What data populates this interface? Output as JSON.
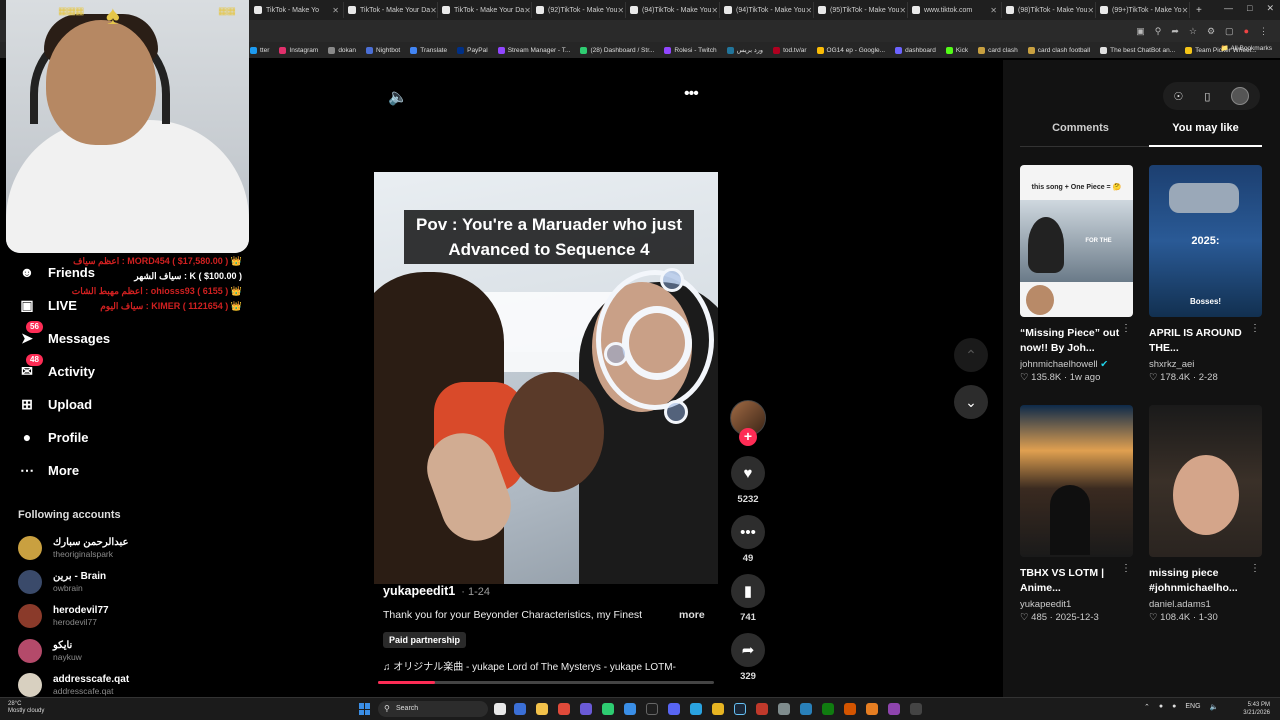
{
  "browser": {
    "tabs": [
      {
        "label": "TikTok - Make Yo"
      },
      {
        "label": "TikTok - Make Your Da"
      },
      {
        "label": "TikTok - Make Your Da"
      },
      {
        "label": "(92)TikTok - Make You"
      },
      {
        "label": "(94)TikTok - Make You"
      },
      {
        "label": "(94)TikTok - Make You"
      },
      {
        "label": "(95)TikTok - Make You"
      },
      {
        "label": "www.tiktok.com"
      },
      {
        "label": "(98)TikTok - Make You"
      },
      {
        "label": "(99+)TikTok - Make Yo"
      }
    ],
    "bookmarks": [
      {
        "label": "tter",
        "color": "#1d9bf0"
      },
      {
        "label": "Instagram",
        "color": "#e1306c"
      },
      {
        "label": "dokan",
        "color": "#8a8a8a"
      },
      {
        "label": "Nightbot",
        "color": "#4b6fd6"
      },
      {
        "label": "Translate",
        "color": "#4285f4"
      },
      {
        "label": "PayPal",
        "color": "#003087"
      },
      {
        "label": "Stream Manager - T...",
        "color": "#9146ff"
      },
      {
        "label": "(28) Dashboard / Str...",
        "color": "#2ecc71"
      },
      {
        "label": "Rolesi - Twitch",
        "color": "#9146ff"
      },
      {
        "label": "ورد بريس",
        "color": "#21759b"
      },
      {
        "label": "tod.tv/ar",
        "color": "#b00020"
      },
      {
        "label": "OG14 ep - Google...",
        "color": "#fbbc05"
      },
      {
        "label": "dashboard",
        "color": "#6c63ff"
      },
      {
        "label": "Kick",
        "color": "#53fc18"
      },
      {
        "label": "card clash",
        "color": "#c8a040"
      },
      {
        "label": "card clash football",
        "color": "#c8a040"
      },
      {
        "label": "The best ChatBot an...",
        "color": "#e0e0e0"
      },
      {
        "label": "Team Picker Wheel...",
        "color": "#f5c518"
      }
    ],
    "all_bookmarks": "All Bookmarks"
  },
  "overlay": {
    "donations": [
      "اعظم سياف : MORD454 ( $17,580.00 ) 👑",
      "سياف الشهر : K ( $100.00 )",
      "اعظم مهبط الشات : ohiosss93 ( 6155 ) 👑",
      "سياف اليوم : KIMER ( 1121654 ) 👑"
    ]
  },
  "nav": {
    "items": [
      {
        "label": "Friends",
        "icon": "friends-icon",
        "count": ""
      },
      {
        "label": "LIVE",
        "icon": "live-icon",
        "count": ""
      },
      {
        "label": "Messages",
        "icon": "messages-icon",
        "count": "56"
      },
      {
        "label": "Activity",
        "icon": "activity-icon",
        "count": "48"
      },
      {
        "label": "Upload",
        "icon": "upload-icon",
        "count": ""
      },
      {
        "label": "Profile",
        "icon": "profile-icon",
        "count": ""
      },
      {
        "label": "More",
        "icon": "more-icon",
        "count": ""
      }
    ],
    "following_title": "Following accounts",
    "following": [
      {
        "name": "عبدالرحمن سبارك",
        "user": "theoriginalspark",
        "color": "#c9a040"
      },
      {
        "name": "برين - Brain",
        "user": "owbrain",
        "color": "#3a4a6a"
      },
      {
        "name": "herodevil77",
        "user": "herodevil77",
        "color": "#8a3a2a"
      },
      {
        "name": "نايكو",
        "user": "naykuw",
        "color": "#b44a6a"
      },
      {
        "name": "addresscafe.qat",
        "user": "addresscafe.qat",
        "color": "#d8d0c0"
      }
    ]
  },
  "video": {
    "caption": "Pov : You're a Maruader who just Advanced to Sequence 4",
    "author": "yukapeedit1",
    "date": "· 1-24",
    "description": "Thank you for your Beyonder Characteristics, my Finest",
    "more_label": "more",
    "paid_label": "Paid partnership",
    "music": "♫  オリジナル楽曲 - yukape Lord of The Mysterys - yukape LOTM-",
    "progress": 0.17
  },
  "actions": {
    "likes": "5232",
    "comments": "49",
    "saves": "741",
    "shares": "329"
  },
  "right_panel": {
    "tab_comments": "Comments",
    "tab_you_may_like": "You may like",
    "cards": [
      {
        "title": "“Missing Piece” out now!! By Joh...",
        "author": "johnmichaelhowell",
        "verified": true,
        "likes": "♡ 135.8K",
        "date": "1w ago",
        "thumb_text": "this song + One Piece = 🤔",
        "thumb_sub": "FOR THE"
      },
      {
        "title": "APRIL IS AROUND THE...",
        "author": "shxrkz_aei",
        "verified": false,
        "likes": "♡ 178.4K",
        "date": "2-28",
        "thumb_text": "2025:",
        "thumb_sub": "Bosses!"
      },
      {
        "title": "TBHX VS LOTM | Anime...",
        "author": "yukapeedit1",
        "verified": false,
        "likes": "♡ 485",
        "date": "2025-12-3",
        "thumb_text": "",
        "thumb_sub": ""
      },
      {
        "title": "missing piece #johnmichaelho...",
        "author": "daniel.adams1",
        "verified": false,
        "likes": "♡ 108.4K",
        "date": "1-30",
        "thumb_text": "",
        "thumb_sub": ""
      }
    ]
  },
  "taskbar": {
    "weather_temp": "28°C",
    "weather_desc": "Mostly cloudy",
    "search_placeholder": "Search",
    "lang": "ENG",
    "time": "5:43 PM",
    "date": "3/21/2026"
  }
}
